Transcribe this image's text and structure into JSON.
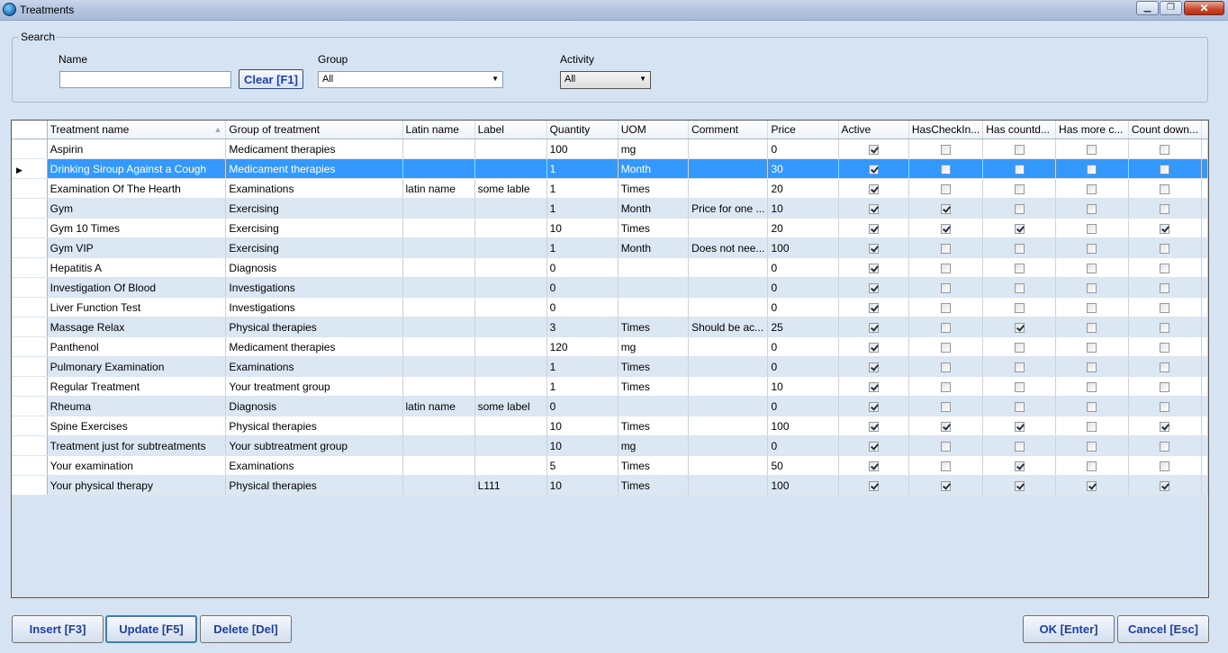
{
  "window": {
    "title": "Treatments",
    "controls": {
      "minimize": "▁",
      "maximize": "❐",
      "close": "✕"
    }
  },
  "search": {
    "caption": "Search",
    "name_label": "Name",
    "name_value": "",
    "clear_label": "Clear [F1]",
    "group_label": "Group",
    "group_value": "All",
    "activity_label": "Activity",
    "activity_value": "All"
  },
  "grid": {
    "columns": [
      "Treatment name",
      "Group of treatment",
      "Latin name",
      "Label",
      "Quantity",
      "UOM",
      "Comment",
      "Price",
      "Active",
      "HasCheckIn...",
      "Has countd...",
      "Has more c...",
      "Count down..."
    ],
    "selected_row": 1,
    "rows": [
      {
        "name": "Aspirin",
        "group": "Medicament therapies",
        "latin": "",
        "label": "",
        "qty": "100",
        "uom": "mg",
        "comment": "",
        "price": "0",
        "checks": [
          true,
          false,
          false,
          false,
          false
        ]
      },
      {
        "name": "Drinking Siroup Against a Cough",
        "group": "Medicament therapies",
        "latin": "",
        "label": "",
        "qty": "1",
        "uom": "Month",
        "comment": "",
        "price": "30",
        "checks": [
          true,
          false,
          false,
          false,
          false
        ]
      },
      {
        "name": "Examination Of The Hearth",
        "group": "Examinations",
        "latin": "latin name",
        "label": "some lable",
        "qty": "1",
        "uom": "Times",
        "comment": "",
        "price": "20",
        "checks": [
          true,
          false,
          false,
          false,
          false
        ]
      },
      {
        "name": "Gym",
        "group": "Exercising",
        "latin": "",
        "label": "",
        "qty": "1",
        "uom": "Month",
        "comment": "Price for one ...",
        "price": "10",
        "checks": [
          true,
          true,
          false,
          false,
          false
        ]
      },
      {
        "name": "Gym 10 Times",
        "group": "Exercising",
        "latin": "",
        "label": "",
        "qty": "10",
        "uom": "Times",
        "comment": "",
        "price": "20",
        "checks": [
          true,
          true,
          true,
          false,
          true
        ]
      },
      {
        "name": "Gym VIP",
        "group": "Exercising",
        "latin": "",
        "label": "",
        "qty": "1",
        "uom": "Month",
        "comment": "Does not nee...",
        "price": "100",
        "checks": [
          true,
          false,
          false,
          false,
          false
        ]
      },
      {
        "name": "Hepatitis A",
        "group": "Diagnosis",
        "latin": "",
        "label": "",
        "qty": "0",
        "uom": "",
        "comment": "",
        "price": "0",
        "checks": [
          true,
          false,
          false,
          false,
          false
        ]
      },
      {
        "name": "Investigation Of Blood",
        "group": "Investigations",
        "latin": "",
        "label": "",
        "qty": "0",
        "uom": "",
        "comment": "",
        "price": "0",
        "checks": [
          true,
          false,
          false,
          false,
          false
        ]
      },
      {
        "name": "Liver Function Test",
        "group": "Investigations",
        "latin": "",
        "label": "",
        "qty": "0",
        "uom": "",
        "comment": "",
        "price": "0",
        "checks": [
          true,
          false,
          false,
          false,
          false
        ]
      },
      {
        "name": "Massage Relax",
        "group": "Physical therapies",
        "latin": "",
        "label": "",
        "qty": "3",
        "uom": "Times",
        "comment": "Should be ac...",
        "price": "25",
        "checks": [
          true,
          false,
          true,
          false,
          false
        ]
      },
      {
        "name": "Panthenol",
        "group": "Medicament therapies",
        "latin": "",
        "label": "",
        "qty": "120",
        "uom": "mg",
        "comment": "",
        "price": "0",
        "checks": [
          true,
          false,
          false,
          false,
          false
        ]
      },
      {
        "name": "Pulmonary Examination",
        "group": "Examinations",
        "latin": "",
        "label": "",
        "qty": "1",
        "uom": "Times",
        "comment": "",
        "price": "0",
        "checks": [
          true,
          false,
          false,
          false,
          false
        ]
      },
      {
        "name": "Regular Treatment",
        "group": "Your treatment group",
        "latin": "",
        "label": "",
        "qty": "1",
        "uom": "Times",
        "comment": "",
        "price": "10",
        "checks": [
          true,
          false,
          false,
          false,
          false
        ]
      },
      {
        "name": "Rheuma",
        "group": "Diagnosis",
        "latin": "latin name",
        "label": "some label",
        "qty": "0",
        "uom": "",
        "comment": "",
        "price": "0",
        "checks": [
          true,
          false,
          false,
          false,
          false
        ]
      },
      {
        "name": "Spine Exercises",
        "group": "Physical therapies",
        "latin": "",
        "label": "",
        "qty": "10",
        "uom": "Times",
        "comment": "",
        "price": "100",
        "checks": [
          true,
          true,
          true,
          false,
          true
        ]
      },
      {
        "name": "Treatment just for subtreatments",
        "group": "Your subtreatment group",
        "latin": "",
        "label": "",
        "qty": "10",
        "uom": "mg",
        "comment": "",
        "price": "0",
        "checks": [
          true,
          false,
          false,
          false,
          false
        ]
      },
      {
        "name": "Your examination",
        "group": "Examinations",
        "latin": "",
        "label": "",
        "qty": "5",
        "uom": "Times",
        "comment": "",
        "price": "50",
        "checks": [
          true,
          false,
          true,
          false,
          false
        ]
      },
      {
        "name": "Your physical therapy",
        "group": "Physical therapies",
        "latin": "",
        "label": "L111",
        "qty": "10",
        "uom": "Times",
        "comment": "",
        "price": "100",
        "checks": [
          true,
          true,
          true,
          true,
          true
        ]
      }
    ]
  },
  "buttons": {
    "insert": "Insert [F3]",
    "update": "Update [F5]",
    "delete": "Delete [Del]",
    "ok": "OK [Enter]",
    "cancel": "Cancel [Esc]"
  }
}
